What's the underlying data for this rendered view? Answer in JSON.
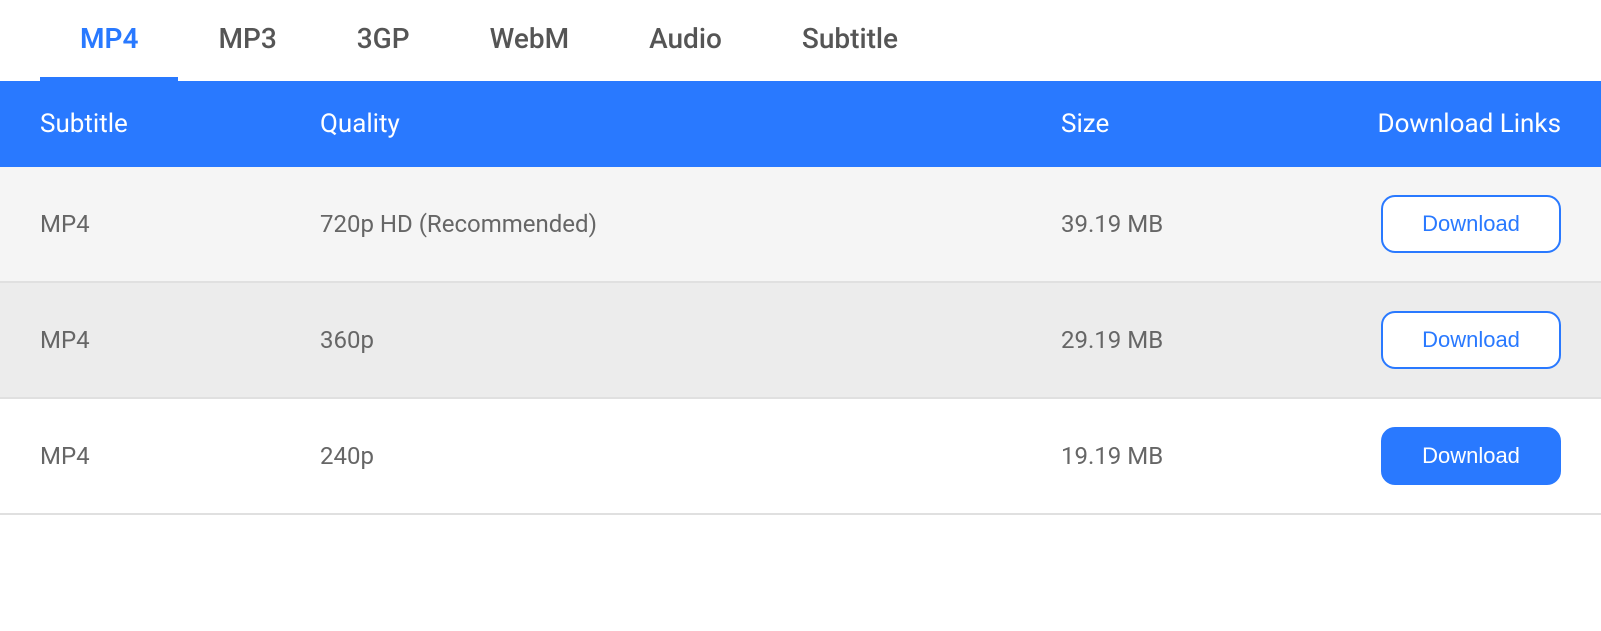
{
  "tabs": [
    {
      "id": "mp4",
      "label": "MP4",
      "active": true
    },
    {
      "id": "mp3",
      "label": "MP3",
      "active": false
    },
    {
      "id": "3gp",
      "label": "3GP",
      "active": false
    },
    {
      "id": "webm",
      "label": "WebM",
      "active": false
    },
    {
      "id": "audio",
      "label": "Audio",
      "active": false
    },
    {
      "id": "subtitle",
      "label": "Subtitle",
      "active": false
    }
  ],
  "table": {
    "headers": {
      "subtitle": "Subtitle",
      "quality": "Quality",
      "size": "Size",
      "download_links": "Download Links"
    },
    "rows": [
      {
        "subtitle": "MP4",
        "quality": "720p HD (Recommended)",
        "size": "39.19 MB",
        "download_label": "Download",
        "filled": false
      },
      {
        "subtitle": "MP4",
        "quality": "360p",
        "size": "29.19 MB",
        "download_label": "Download",
        "filled": false
      },
      {
        "subtitle": "MP4",
        "quality": "240p",
        "size": "19.19 MB",
        "download_label": "Download",
        "filled": true
      }
    ]
  },
  "colors": {
    "accent": "#2979FF"
  }
}
